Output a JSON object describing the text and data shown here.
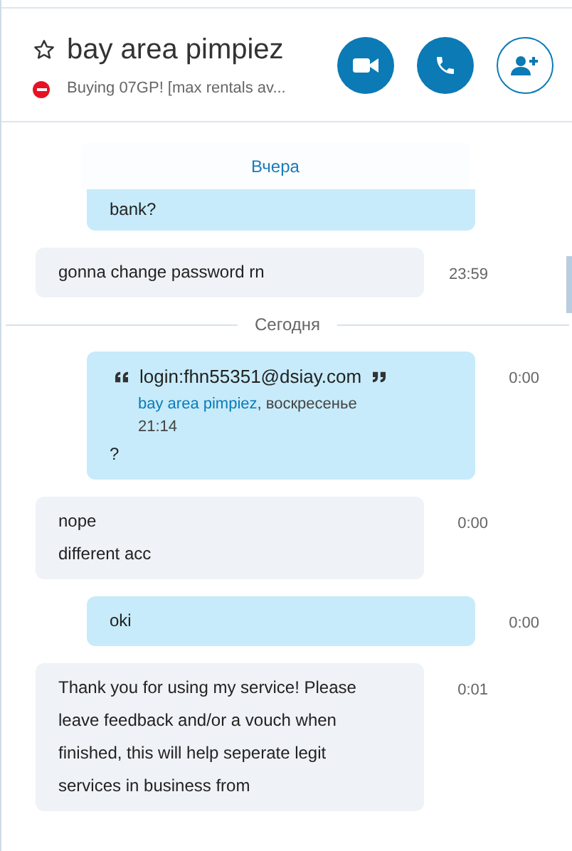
{
  "header": {
    "title": "bay area pimpiez",
    "favorite": false,
    "busy": true,
    "mood": "Buying 07GP! [max rentals av..."
  },
  "sticky_date": "Вчера",
  "messages": [
    {
      "kind": "outgoing",
      "lines": [
        "bank?"
      ],
      "cut_top": true
    },
    {
      "kind": "incoming",
      "lines": [
        "gonna change password rn"
      ],
      "time": "23:59"
    },
    {
      "kind": "divider",
      "label": "Сегодня"
    },
    {
      "kind": "outgoing",
      "quote": {
        "text": "login:fhn55351@dsiay.com",
        "author": "bay area pimpiez",
        "meta": ", воскресенье",
        "time": "21:14"
      },
      "lines": [
        "?"
      ],
      "time": "0:00"
    },
    {
      "kind": "incoming",
      "lines": [
        "nope",
        "different acc"
      ],
      "time": "0:00"
    },
    {
      "kind": "outgoing",
      "lines": [
        "oki"
      ],
      "time": "0:00"
    },
    {
      "kind": "incoming",
      "lines": [
        "Thank you for using my service! Please leave feedback and/or a vouch when finished, this will help seperate legit services in business from"
      ],
      "time": "0:01"
    }
  ]
}
